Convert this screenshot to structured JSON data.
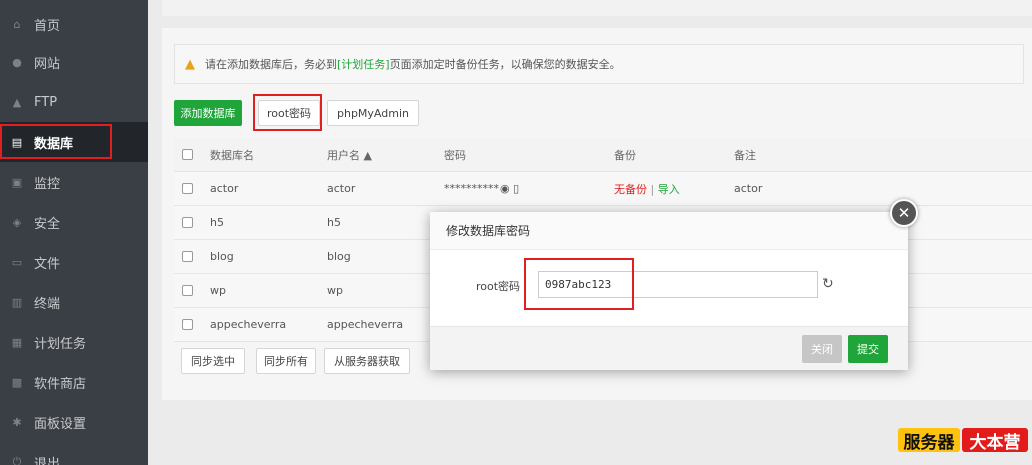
{
  "sidebar": {
    "items": [
      {
        "label": "首页",
        "icon": "home-icon",
        "glyph": "⌂"
      },
      {
        "label": "网站",
        "icon": "globe-icon",
        "glyph": "●"
      },
      {
        "label": "FTP",
        "icon": "ftp-icon",
        "glyph": "▲"
      },
      {
        "label": "数据库",
        "icon": "database-icon",
        "glyph": "▤"
      },
      {
        "label": "监控",
        "icon": "monitor-icon",
        "glyph": "▣"
      },
      {
        "label": "安全",
        "icon": "shield-icon",
        "glyph": "◈"
      },
      {
        "label": "文件",
        "icon": "folder-icon",
        "glyph": "▭"
      },
      {
        "label": "终端",
        "icon": "terminal-icon",
        "glyph": "▥"
      },
      {
        "label": "计划任务",
        "icon": "calendar-icon",
        "glyph": "▦"
      },
      {
        "label": "软件商店",
        "icon": "apps-icon",
        "glyph": "▩"
      },
      {
        "label": "面板设置",
        "icon": "gear-icon",
        "glyph": "✱"
      },
      {
        "label": "退出",
        "icon": "logout-icon",
        "glyph": "⏻"
      }
    ],
    "active_index": 3
  },
  "notice": {
    "icon": "warning-icon",
    "text_before": "请在添加数据库后，务必到",
    "link": "[计划任务]",
    "text_after": "页面添加定时备份任务，以确保您的数据安全。"
  },
  "toolbar": {
    "add_db": "添加数据库",
    "root_pw": "root密码",
    "phpmyadmin": "phpMyAdmin"
  },
  "table": {
    "headers": {
      "name": "数据库名",
      "user": "用户名 ▲",
      "password": "密码",
      "backup": "备份",
      "note": "备注"
    },
    "rows": [
      {
        "name": "actor",
        "user": "actor",
        "password": "**********",
        "backup_none": "无备份",
        "backup_sep": " | ",
        "backup_import": "导入",
        "note": "actor"
      },
      {
        "name": "h5",
        "user": "h5"
      },
      {
        "name": "blog",
        "user": "blog"
      },
      {
        "name": "wp",
        "user": "wp"
      },
      {
        "name": "appecheverra",
        "user": "appecheverra"
      }
    ]
  },
  "footer_buttons": {
    "sync_selected": "同步选中",
    "sync_all": "同步所有",
    "from_server": "从服务器获取"
  },
  "modal": {
    "title": "修改数据库密码",
    "label": "root密码",
    "value": "0987abc123",
    "close": "关闭",
    "submit": "提交"
  },
  "watermark": {
    "left": "服务器",
    "right": "大本营"
  }
}
